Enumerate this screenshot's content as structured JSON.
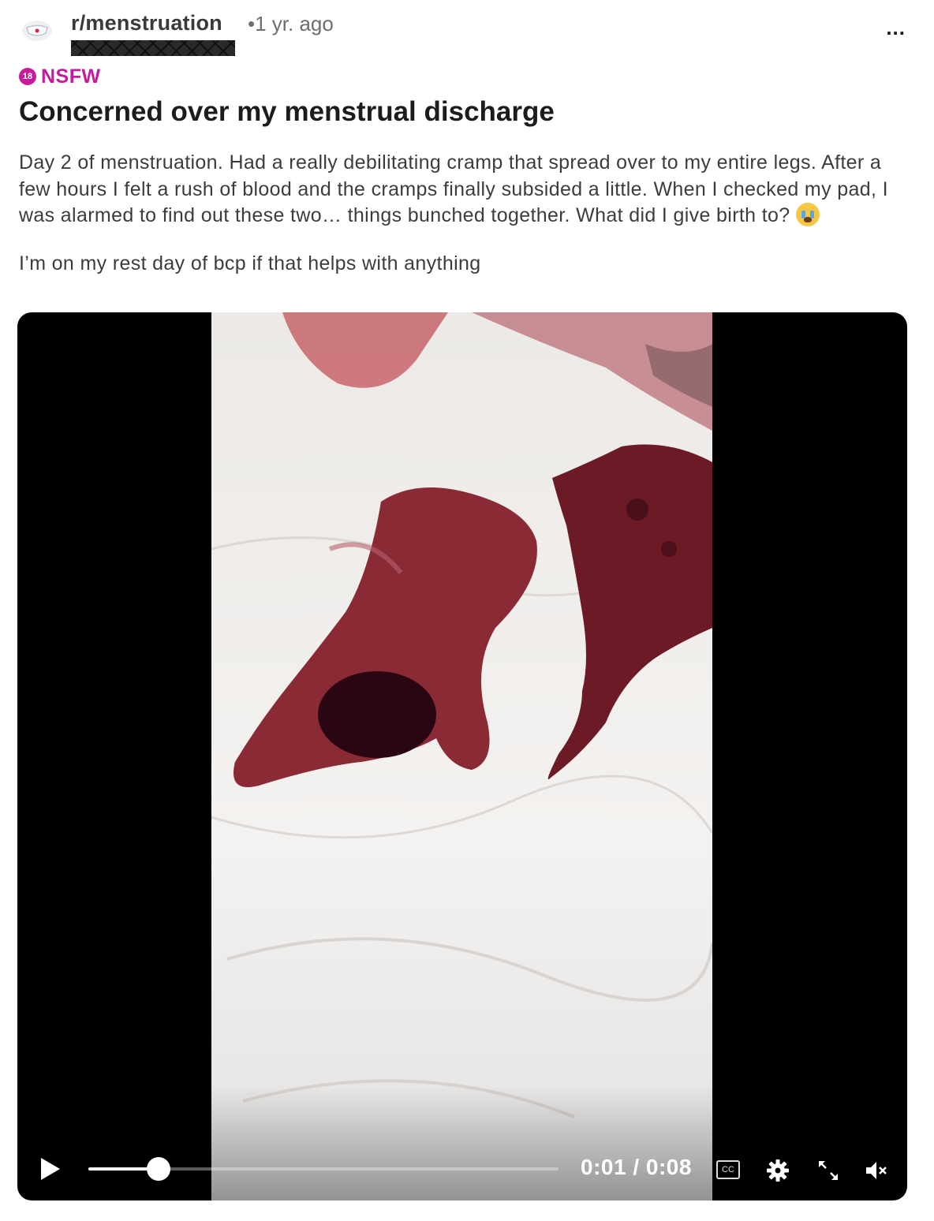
{
  "post": {
    "subreddit": "r/menstruation",
    "age": "•1 yr. ago",
    "more_label": "...",
    "nsfw_badge": "18",
    "nsfw_label": "NSFW",
    "title": "Concerned over my menstrual discharge",
    "body_paragraph_1": "Day 2 of menstruation. Had a really debilitating cramp that spread over to my entire legs. After a few hours I felt a rush of blood and the cramps finally subsided a little. When I checked my pad, I was alarmed to find out these two… things bunched together. What did I give birth to?",
    "body_paragraph_2": "I’m on my rest day of bcp if that helps with anything"
  },
  "video": {
    "time_display": "0:01 / 0:08",
    "progress_fraction": 0.15,
    "cc_label": "CC",
    "muted": true
  },
  "icons": {
    "subreddit": "pad-icon",
    "play": "play-icon",
    "settings": "gear-icon",
    "fullscreen": "expand-icon",
    "volume": "muted-speaker-icon",
    "emoji": "loudly-crying-face-emoji"
  },
  "colors": {
    "nsfw": "#c61b9c",
    "video_bg": "#000000"
  }
}
